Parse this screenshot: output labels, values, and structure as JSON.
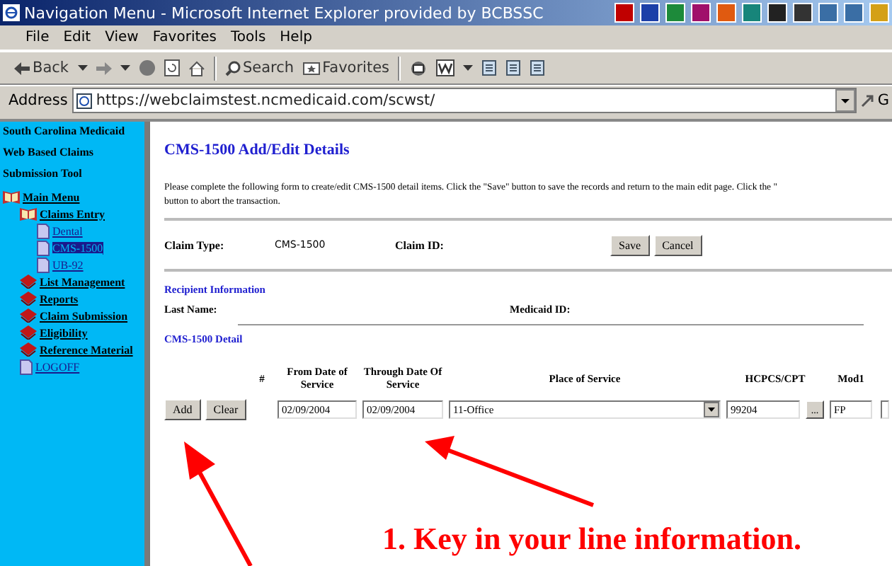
{
  "window": {
    "title": "Navigation Menu - Microsoft Internet Explorer provided by BCBSSC"
  },
  "menu": [
    "File",
    "Edit",
    "View",
    "Favorites",
    "Tools",
    "Help"
  ],
  "toolbar": [
    {
      "kind": "back",
      "label": "Back"
    },
    {
      "kind": "forward"
    },
    {
      "kind": "stop"
    },
    {
      "kind": "refresh"
    },
    {
      "kind": "home"
    },
    {
      "kind": "search",
      "label": "Search"
    },
    {
      "kind": "favorites",
      "label": "Favorites"
    },
    {
      "kind": "mail"
    },
    {
      "kind": "editor"
    },
    {
      "kind": "page"
    },
    {
      "kind": "page"
    },
    {
      "kind": "page"
    }
  ],
  "address": {
    "label": "Address",
    "value": "https://webclaimstest.ncmedicaid.com/scwst/",
    "go": "G"
  },
  "sidebar": {
    "heading": [
      "South Carolina Medicaid",
      "Web Based Claims",
      "Submission Tool"
    ],
    "tree": [
      {
        "label": "Main Menu",
        "kind": "book",
        "selected": false,
        "children": [
          {
            "label": "Claims Entry",
            "kind": "book",
            "selected": false,
            "children": [
              {
                "label": "Dental",
                "kind": "page",
                "selected": false
              },
              {
                "label": "CMS-1500",
                "kind": "page",
                "selected": true
              },
              {
                "label": "UB-92",
                "kind": "page",
                "selected": false
              }
            ]
          },
          {
            "label": "List Management",
            "kind": "closed",
            "selected": false
          },
          {
            "label": "Reports",
            "kind": "closed",
            "selected": false
          },
          {
            "label": "Claim Submission",
            "kind": "closed",
            "selected": false
          },
          {
            "label": "Eligibility",
            "kind": "closed",
            "selected": false
          },
          {
            "label": "Reference Material",
            "kind": "closed",
            "selected": false
          },
          {
            "label": "LOGOFF",
            "kind": "page",
            "selected": false
          }
        ]
      }
    ]
  },
  "form": {
    "title": "CMS-1500 Add/Edit Details",
    "description": [
      "Please complete the following form to create/edit CMS-1500 detail items. Click the \"Save\" button to save the records and return to the main edit page. Click the \"",
      "button to abort the transaction."
    ],
    "claim_type_label": "Claim Type:",
    "claim_type": "CMS-1500",
    "claim_id_label": "Claim ID:",
    "buttons": [
      "Save",
      "Cancel"
    ],
    "recipient_heading": "Recipient Information",
    "last_name_label": "Last Name:",
    "medicaid_id_label": "Medicaid ID:",
    "detail_heading": "CMS-1500 Detail",
    "columns": [
      "#",
      "From Date of Service",
      "Through Date Of Service",
      "Place of Service",
      "HCPCS/CPT",
      "Mod1"
    ],
    "row_buttons": [
      "Add",
      "Clear"
    ],
    "row": {
      "from_date": "02/09/2004",
      "through_date": "02/09/2004",
      "place_of_service": "11-Office",
      "hcpcs": "99204",
      "lookup": "...",
      "mod1": "FP"
    }
  },
  "callout": {
    "text": "1. Key in your line information."
  }
}
